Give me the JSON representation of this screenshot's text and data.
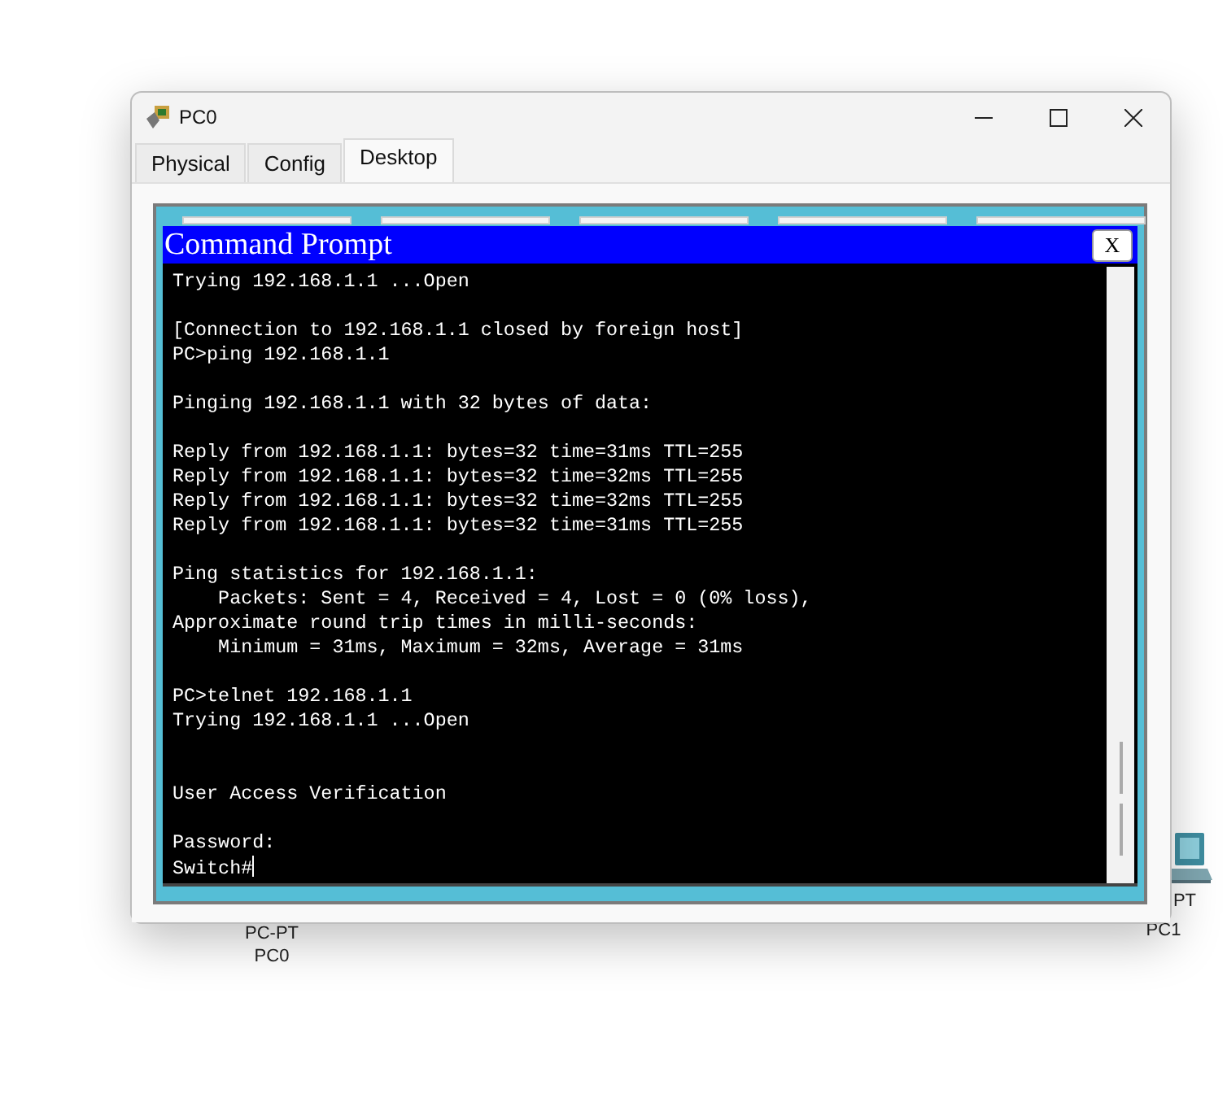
{
  "canvas": {
    "devices": [
      {
        "type": "PC-PT",
        "name": "PC0"
      },
      {
        "type": "PT",
        "name": "PC1"
      }
    ]
  },
  "window": {
    "title": "PC0",
    "tabs": [
      {
        "label": "Physical",
        "selected": false
      },
      {
        "label": "Config",
        "selected": false
      },
      {
        "label": "Desktop",
        "selected": true
      }
    ]
  },
  "command_prompt": {
    "title": "Command Prompt",
    "close": "X",
    "lines": [
      {
        "kind": "output",
        "text": "Trying 192.168.1.1 ...Open"
      },
      {
        "kind": "blank"
      },
      {
        "kind": "output",
        "text": "[Connection to 192.168.1.1 closed by foreign host]"
      },
      {
        "kind": "output",
        "text": "PC>ping 192.168.1.1"
      },
      {
        "kind": "blank"
      },
      {
        "kind": "output",
        "text": "Pinging 192.168.1.1 with 32 bytes of data:"
      },
      {
        "kind": "blank"
      },
      {
        "kind": "output",
        "text": "Reply from 192.168.1.1: bytes=32 time=31ms TTL=255"
      },
      {
        "kind": "output",
        "text": "Reply from 192.168.1.1: bytes=32 time=32ms TTL=255"
      },
      {
        "kind": "output",
        "text": "Reply from 192.168.1.1: bytes=32 time=32ms TTL=255"
      },
      {
        "kind": "output",
        "text": "Reply from 192.168.1.1: bytes=32 time=31ms TTL=255"
      },
      {
        "kind": "blank"
      },
      {
        "kind": "output",
        "text": "Ping statistics for 192.168.1.1:"
      },
      {
        "kind": "output",
        "text": "    Packets: Sent = 4, Received = 4, Lost = 0 (0% loss),"
      },
      {
        "kind": "output",
        "text": "Approximate round trip times in milli-seconds:"
      },
      {
        "kind": "output",
        "text": "    Minimum = 31ms, Maximum = 32ms, Average = 31ms"
      },
      {
        "kind": "blank"
      },
      {
        "kind": "output",
        "text": "PC>telnet 192.168.1.1"
      },
      {
        "kind": "output",
        "text": "Trying 192.168.1.1 ...Open"
      },
      {
        "kind": "blank"
      },
      {
        "kind": "blank"
      },
      {
        "kind": "output",
        "text": "User Access Verification"
      },
      {
        "kind": "blank"
      },
      {
        "kind": "output",
        "text": "Password:"
      },
      {
        "kind": "output",
        "text": "Switch#"
      }
    ],
    "cursor": true
  }
}
